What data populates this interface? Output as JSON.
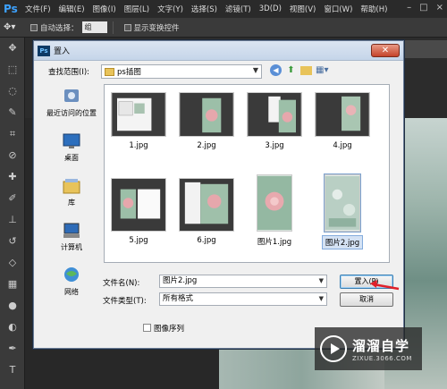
{
  "app": {
    "logo": "Ps",
    "menus": [
      "文件(F)",
      "编辑(E)",
      "图像(I)",
      "图层(L)",
      "文字(Y)",
      "选择(S)",
      "滤镜(T)",
      "3D(D)",
      "视图(V)",
      "窗口(W)",
      "帮助(H)"
    ],
    "window_controls": [
      "–",
      "□",
      "×"
    ]
  },
  "options_bar": {
    "auto_select_label": "自动选择：",
    "auto_select_value": "组",
    "show_transform_label": "显示变换控件"
  },
  "dialog": {
    "title": "置入",
    "close_symbol": "✕",
    "look_in_label": "查找范围(I):",
    "look_in_value": "ps插图",
    "places": [
      {
        "label": "最近访问的位置",
        "icon": "recent-places-icon"
      },
      {
        "label": "桌面",
        "icon": "desktop-icon"
      },
      {
        "label": "库",
        "icon": "libraries-icon"
      },
      {
        "label": "计算机",
        "icon": "computer-icon"
      },
      {
        "label": "网络",
        "icon": "network-icon"
      }
    ],
    "files": [
      {
        "name": "1.jpg"
      },
      {
        "name": "2.jpg"
      },
      {
        "name": "3.jpg"
      },
      {
        "name": "4.jpg"
      },
      {
        "name": "5.jpg"
      },
      {
        "name": "6.jpg"
      },
      {
        "name": "图片1.jpg"
      },
      {
        "name": "图片2.jpg",
        "selected": true
      }
    ],
    "file_name_label": "文件名(N):",
    "file_name_value": "图片2.jpg",
    "file_type_label": "文件类型(T):",
    "file_type_value": "所有格式",
    "place_button": "置入(P)",
    "cancel_button": "取消",
    "image_sequence_label": "图像序列"
  },
  "watermark": {
    "name": "溜溜自学",
    "url": "ZIXUE.3066.COM"
  },
  "colors": {
    "accent": "#3da2ff",
    "selection": "#d4e2f4",
    "arrow": "#e0202a"
  }
}
